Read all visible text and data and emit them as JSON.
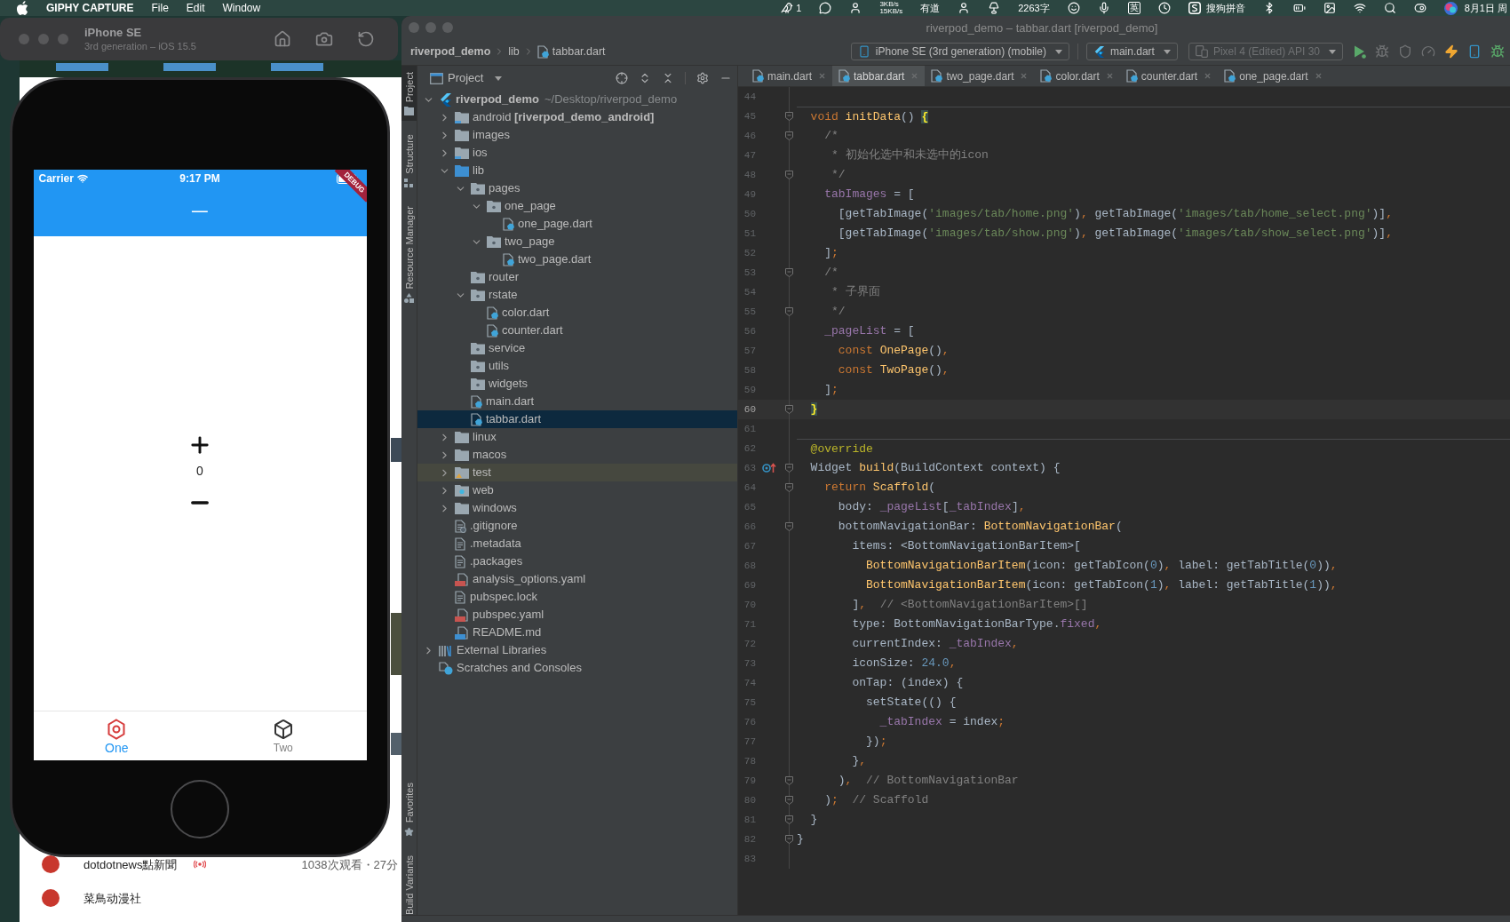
{
  "menu_bar": {
    "app_name": "GIPHY CAPTURE",
    "menus": [
      "File",
      "Edit",
      "Window"
    ],
    "notification_count": "1",
    "network_up": "3KB/s",
    "network_down": "15KB/s",
    "app_label": "有道",
    "word_count": "2263字",
    "input_mode": "英",
    "input_method": "搜狗拼音",
    "date": "8月1日 周"
  },
  "simulator": {
    "device": "iPhone SE",
    "subtitle": "3rd generation – iOS 15.5"
  },
  "phone_app": {
    "carrier": "Carrier",
    "time": "9:17 PM",
    "title": "一",
    "banner": "DEBUG",
    "counter": "0",
    "nav_items": [
      {
        "label": "One",
        "selected": true
      },
      {
        "label": "Two",
        "selected": false
      }
    ]
  },
  "browser_page": {
    "items": [
      {
        "channel": "dotdotnews點新聞",
        "live": true,
        "stats": "1038次观看・27分"
      },
      {
        "channel": "菜鳥动漫社",
        "live": false
      }
    ]
  },
  "ide_window": {
    "title": "riverpod_demo – tabbar.dart [riverpod_demo]",
    "breadcrumbs": [
      "riverpod_demo",
      "lib",
      "tabbar.dart"
    ],
    "run_configs": [
      {
        "label": "iPhone SE (3rd generation) (mobile)",
        "disabled": false
      },
      {
        "label": "main.dart",
        "disabled": false
      },
      {
        "label": "Pixel 4 (Edited) API 30",
        "disabled": true
      }
    ]
  },
  "tool_strip": {
    "top": [
      {
        "label": "Project",
        "selected": true
      },
      {
        "label": "Structure",
        "selected": false
      },
      {
        "label": "Resource Manager",
        "selected": false
      }
    ],
    "bottom": [
      {
        "label": "Favorites",
        "selected": false
      },
      {
        "label": "Build Variants",
        "selected": false
      }
    ]
  },
  "project_panel": {
    "title": "Project"
  },
  "project_tree": [
    {
      "label": "riverpod_demo",
      "path": "~/Desktop/riverpod_demo",
      "kind": "flutter_project",
      "expanded": true,
      "selected": false,
      "children": [
        {
          "label": "android **[riverpod_demo_android]**",
          "kind": "module",
          "expanded": false,
          "selected": false
        },
        {
          "label": "images",
          "kind": "folder",
          "expanded": false,
          "selected": false
        },
        {
          "label": "ios",
          "kind": "module",
          "expanded": false,
          "selected": false
        },
        {
          "label": "lib",
          "kind": "source_root",
          "expanded": true,
          "selected": false,
          "children": [
            {
              "label": "pages",
              "kind": "package",
              "expanded": true,
              "selected": false,
              "children": [
                {
                  "label": "one_page",
                  "kind": "package",
                  "expanded": true,
                  "selected": false,
                  "children": [
                    {
                      "label": "one_page.dart",
                      "kind": "dart",
                      "selected": false
                    }
                  ]
                },
                {
                  "label": "two_page",
                  "kind": "package",
                  "expanded": true,
                  "selected": false,
                  "children": [
                    {
                      "label": "two_page.dart",
                      "kind": "dart",
                      "selected": false
                    }
                  ]
                }
              ]
            },
            {
              "label": "router",
              "kind": "package",
              "selected": false
            },
            {
              "label": "rstate",
              "kind": "package",
              "expanded": true,
              "selected": false,
              "children": [
                {
                  "label": "color.dart",
                  "kind": "dart",
                  "selected": false
                },
                {
                  "label": "counter.dart",
                  "kind": "dart",
                  "selected": false
                }
              ]
            },
            {
              "label": "service",
              "kind": "package",
              "selected": false
            },
            {
              "label": "utils",
              "kind": "package",
              "selected": false
            },
            {
              "label": "widgets",
              "kind": "package",
              "selected": false
            },
            {
              "label": "main.dart",
              "kind": "dart",
              "selected": false
            },
            {
              "label": "tabbar.dart",
              "kind": "dart",
              "selected": true
            }
          ]
        },
        {
          "label": "linux",
          "kind": "folder",
          "expanded": false,
          "selected": false
        },
        {
          "label": "macos",
          "kind": "folder",
          "expanded": false,
          "selected": false
        },
        {
          "label": "test",
          "kind": "test_root",
          "expanded": false,
          "selected": false
        },
        {
          "label": "web",
          "kind": "web",
          "expanded": false,
          "selected": false
        },
        {
          "label": "windows",
          "kind": "folder",
          "expanded": false,
          "selected": false
        },
        {
          "label": ".gitignore",
          "kind": "ignore",
          "selected": false
        },
        {
          "label": ".metadata",
          "kind": "text",
          "selected": false
        },
        {
          "label": ".packages",
          "kind": "text",
          "selected": false
        },
        {
          "label": "analysis_options.yaml",
          "kind": "yaml",
          "selected": false
        },
        {
          "label": "pubspec.lock",
          "kind": "text",
          "selected": false
        },
        {
          "label": "pubspec.yaml",
          "kind": "yaml",
          "selected": false
        },
        {
          "label": "README.md",
          "kind": "markdown",
          "selected": false
        }
      ]
    },
    {
      "label": "External Libraries",
      "kind": "libraries",
      "expanded": false,
      "selected": false
    },
    {
      "label": "Scratches and Consoles",
      "kind": "scratches",
      "selected": false
    }
  ],
  "editor_tabs": [
    {
      "label": "main.dart",
      "selected": false
    },
    {
      "label": "tabbar.dart",
      "selected": true
    },
    {
      "label": "two_page.dart",
      "selected": false
    },
    {
      "label": "color.dart",
      "selected": false
    },
    {
      "label": "counter.dart",
      "selected": false
    },
    {
      "label": "one_page.dart",
      "selected": false
    }
  ],
  "editor_lines": [
    {
      "number": "44",
      "current": false,
      "fold": false,
      "override_marker": false,
      "method_separator": false
    },
    {
      "number": "45",
      "current": false,
      "fold": true,
      "override_marker": false,
      "method_separator": true,
      "tokens": [
        {
          "kind": "keyword",
          "text": "  void "
        },
        {
          "kind": "function",
          "text": "initData"
        },
        {
          "kind": "plain",
          "text": "() "
        },
        {
          "kind": "brace",
          "text": "{"
        }
      ]
    },
    {
      "number": "46",
      "current": false,
      "fold": true,
      "override_marker": false,
      "method_separator": false,
      "tokens": [
        {
          "kind": "comment",
          "text": "    /*"
        }
      ]
    },
    {
      "number": "47",
      "current": false,
      "fold": false,
      "override_marker": false,
      "method_separator": false,
      "tokens": [
        {
          "kind": "comment",
          "text": "     * 初始化选中和未选中的icon"
        }
      ]
    },
    {
      "number": "48",
      "current": false,
      "fold": true,
      "override_marker": false,
      "method_separator": false,
      "tokens": [
        {
          "kind": "comment",
          "text": "     */"
        }
      ]
    },
    {
      "number": "49",
      "current": false,
      "fold": false,
      "override_marker": false,
      "method_separator": false,
      "tokens": [
        {
          "kind": "field",
          "text": "    tabImages"
        },
        {
          "kind": "plain",
          "text": " = ["
        }
      ]
    },
    {
      "number": "50",
      "current": false,
      "fold": false,
      "override_marker": false,
      "method_separator": false,
      "tokens": [
        {
          "kind": "plain",
          "text": "      [getTabImage("
        },
        {
          "kind": "string",
          "text": "'images/tab/home.png'"
        },
        {
          "kind": "plain",
          "text": ")"
        },
        {
          "kind": "punct",
          "text": ", "
        },
        {
          "kind": "plain",
          "text": "getTabImage("
        },
        {
          "kind": "string",
          "text": "'images/tab/home_select.png'"
        },
        {
          "kind": "plain",
          "text": ")]"
        },
        {
          "kind": "punct",
          "text": ","
        }
      ]
    },
    {
      "number": "51",
      "current": false,
      "fold": false,
      "override_marker": false,
      "method_separator": false,
      "tokens": [
        {
          "kind": "plain",
          "text": "      [getTabImage("
        },
        {
          "kind": "string",
          "text": "'images/tab/show.png'"
        },
        {
          "kind": "plain",
          "text": ")"
        },
        {
          "kind": "punct",
          "text": ", "
        },
        {
          "kind": "plain",
          "text": "getTabImage("
        },
        {
          "kind": "string",
          "text": "'images/tab/show_select.png'"
        },
        {
          "kind": "plain",
          "text": ")]"
        },
        {
          "kind": "punct",
          "text": ","
        }
      ]
    },
    {
      "number": "52",
      "current": false,
      "fold": false,
      "override_marker": false,
      "method_separator": false,
      "tokens": [
        {
          "kind": "plain",
          "text": "    ]"
        },
        {
          "kind": "punct",
          "text": ";"
        }
      ]
    },
    {
      "number": "53",
      "current": false,
      "fold": true,
      "override_marker": false,
      "method_separator": false,
      "tokens": [
        {
          "kind": "comment",
          "text": "    /*"
        }
      ]
    },
    {
      "number": "54",
      "current": false,
      "fold": false,
      "override_marker": false,
      "method_separator": false,
      "tokens": [
        {
          "kind": "comment",
          "text": "     * 子界面"
        }
      ]
    },
    {
      "number": "55",
      "current": false,
      "fold": true,
      "override_marker": false,
      "method_separator": false,
      "tokens": [
        {
          "kind": "comment",
          "text": "     */"
        }
      ]
    },
    {
      "number": "56",
      "current": false,
      "fold": false,
      "override_marker": false,
      "method_separator": false,
      "tokens": [
        {
          "kind": "field",
          "text": "    _pageList"
        },
        {
          "kind": "plain",
          "text": " = ["
        }
      ]
    },
    {
      "number": "57",
      "current": false,
      "fold": false,
      "override_marker": false,
      "method_separator": false,
      "tokens": [
        {
          "kind": "keyword",
          "text": "      const "
        },
        {
          "kind": "function",
          "text": "OnePage"
        },
        {
          "kind": "plain",
          "text": "()"
        },
        {
          "kind": "punct",
          "text": ","
        }
      ]
    },
    {
      "number": "58",
      "current": false,
      "fold": false,
      "override_marker": false,
      "method_separator": false,
      "tokens": [
        {
          "kind": "keyword",
          "text": "      const "
        },
        {
          "kind": "function",
          "text": "TwoPage"
        },
        {
          "kind": "plain",
          "text": "()"
        },
        {
          "kind": "punct",
          "text": ","
        }
      ]
    },
    {
      "number": "59",
      "current": false,
      "fold": false,
      "override_marker": false,
      "method_separator": false,
      "tokens": [
        {
          "kind": "plain",
          "text": "    ]"
        },
        {
          "kind": "punct",
          "text": ";"
        }
      ]
    },
    {
      "number": "60",
      "current": true,
      "fold": true,
      "override_marker": false,
      "method_separator": false,
      "tokens": [
        {
          "kind": "brace",
          "text": "  }"
        }
      ]
    },
    {
      "number": "61",
      "current": false,
      "fold": false,
      "override_marker": false,
      "method_separator": false
    },
    {
      "number": "62",
      "current": false,
      "fold": false,
      "override_marker": false,
      "method_separator": true,
      "tokens": [
        {
          "kind": "annotation",
          "text": "  @override"
        }
      ]
    },
    {
      "number": "63",
      "current": false,
      "fold": true,
      "override_marker": true,
      "method_separator": false,
      "tokens": [
        {
          "kind": "plain",
          "text": "  Widget "
        },
        {
          "kind": "function",
          "text": "build"
        },
        {
          "kind": "plain",
          "text": "(BuildContext context) {"
        }
      ]
    },
    {
      "number": "64",
      "current": false,
      "fold": true,
      "override_marker": false,
      "method_separator": false,
      "tokens": [
        {
          "kind": "keyword",
          "text": "    return "
        },
        {
          "kind": "function",
          "text": "Scaffold"
        },
        {
          "kind": "plain",
          "text": "("
        }
      ]
    },
    {
      "number": "65",
      "current": false,
      "fold": false,
      "override_marker": false,
      "method_separator": false,
      "tokens": [
        {
          "kind": "plain",
          "text": "      body: "
        },
        {
          "kind": "field",
          "text": "_pageList"
        },
        {
          "kind": "plain",
          "text": "["
        },
        {
          "kind": "field",
          "text": "_tabIndex"
        },
        {
          "kind": "plain",
          "text": "]"
        },
        {
          "kind": "punct",
          "text": ","
        }
      ]
    },
    {
      "number": "66",
      "current": false,
      "fold": true,
      "override_marker": false,
      "method_separator": false,
      "tokens": [
        {
          "kind": "plain",
          "text": "      bottomNavigationBar: "
        },
        {
          "kind": "function",
          "text": "BottomNavigationBar"
        },
        {
          "kind": "plain",
          "text": "("
        }
      ]
    },
    {
      "number": "67",
      "current": false,
      "fold": false,
      "override_marker": false,
      "method_separator": false,
      "tokens": [
        {
          "kind": "plain",
          "text": "        items: <BottomNavigationBarItem>["
        }
      ]
    },
    {
      "number": "68",
      "current": false,
      "fold": false,
      "override_marker": false,
      "method_separator": false,
      "tokens": [
        {
          "kind": "function",
          "text": "          BottomNavigationBarItem"
        },
        {
          "kind": "plain",
          "text": "(icon: getTabIcon("
        },
        {
          "kind": "number",
          "text": "0"
        },
        {
          "kind": "plain",
          "text": ")"
        },
        {
          "kind": "punct",
          "text": ", "
        },
        {
          "kind": "plain",
          "text": "label: getTabTitle("
        },
        {
          "kind": "number",
          "text": "0"
        },
        {
          "kind": "plain",
          "text": "))"
        },
        {
          "kind": "punct",
          "text": ","
        }
      ]
    },
    {
      "number": "69",
      "current": false,
      "fold": false,
      "override_marker": false,
      "method_separator": false,
      "tokens": [
        {
          "kind": "function",
          "text": "          BottomNavigationBarItem"
        },
        {
          "kind": "plain",
          "text": "(icon: getTabIcon("
        },
        {
          "kind": "number",
          "text": "1"
        },
        {
          "kind": "plain",
          "text": ")"
        },
        {
          "kind": "punct",
          "text": ", "
        },
        {
          "kind": "plain",
          "text": "label: getTabTitle("
        },
        {
          "kind": "number",
          "text": "1"
        },
        {
          "kind": "plain",
          "text": "))"
        },
        {
          "kind": "punct",
          "text": ","
        }
      ]
    },
    {
      "number": "70",
      "current": false,
      "fold": false,
      "override_marker": false,
      "method_separator": false,
      "tokens": [
        {
          "kind": "plain",
          "text": "        ]"
        },
        {
          "kind": "punct",
          "text": ","
        },
        {
          "kind": "comment",
          "text": "  // <BottomNavigationBarItem>[]"
        }
      ]
    },
    {
      "number": "71",
      "current": false,
      "fold": false,
      "override_marker": false,
      "method_separator": false,
      "tokens": [
        {
          "kind": "plain",
          "text": "        type: BottomNavigationBarType."
        },
        {
          "kind": "field",
          "text": "fixed"
        },
        {
          "kind": "punct",
          "text": ","
        }
      ]
    },
    {
      "number": "72",
      "current": false,
      "fold": false,
      "override_marker": false,
      "method_separator": false,
      "tokens": [
        {
          "kind": "plain",
          "text": "        currentIndex: "
        },
        {
          "kind": "field",
          "text": "_tabIndex"
        },
        {
          "kind": "punct",
          "text": ","
        }
      ]
    },
    {
      "number": "73",
      "current": false,
      "fold": false,
      "override_marker": false,
      "method_separator": false,
      "tokens": [
        {
          "kind": "plain",
          "text": "        iconSize: "
        },
        {
          "kind": "number",
          "text": "24.0"
        },
        {
          "kind": "punct",
          "text": ","
        }
      ]
    },
    {
      "number": "74",
      "current": false,
      "fold": false,
      "override_marker": false,
      "method_separator": false,
      "tokens": [
        {
          "kind": "plain",
          "text": "        onTap: (index) {"
        }
      ]
    },
    {
      "number": "75",
      "current": false,
      "fold": false,
      "override_marker": false,
      "method_separator": false,
      "tokens": [
        {
          "kind": "plain",
          "text": "          setState(() {"
        }
      ]
    },
    {
      "number": "76",
      "current": false,
      "fold": false,
      "override_marker": false,
      "method_separator": false,
      "tokens": [
        {
          "kind": "field",
          "text": "            _tabIndex"
        },
        {
          "kind": "plain",
          "text": " = index"
        },
        {
          "kind": "punct",
          "text": ";"
        }
      ]
    },
    {
      "number": "77",
      "current": false,
      "fold": false,
      "override_marker": false,
      "method_separator": false,
      "tokens": [
        {
          "kind": "plain",
          "text": "          })"
        },
        {
          "kind": "punct",
          "text": ";"
        }
      ]
    },
    {
      "number": "78",
      "current": false,
      "fold": false,
      "override_marker": false,
      "method_separator": false,
      "tokens": [
        {
          "kind": "plain",
          "text": "        }"
        },
        {
          "kind": "punct",
          "text": ","
        }
      ]
    },
    {
      "number": "79",
      "current": false,
      "fold": true,
      "override_marker": false,
      "method_separator": false,
      "tokens": [
        {
          "kind": "plain",
          "text": "      )"
        },
        {
          "kind": "punct",
          "text": ","
        },
        {
          "kind": "comment",
          "text": "  // BottomNavigationBar"
        }
      ]
    },
    {
      "number": "80",
      "current": false,
      "fold": true,
      "override_marker": false,
      "method_separator": false,
      "tokens": [
        {
          "kind": "plain",
          "text": "    )"
        },
        {
          "kind": "punct",
          "text": ";"
        },
        {
          "kind": "comment",
          "text": "  // Scaffold"
        }
      ]
    },
    {
      "number": "81",
      "current": false,
      "fold": true,
      "override_marker": false,
      "method_separator": false,
      "tokens": [
        {
          "kind": "plain",
          "text": "  }"
        }
      ]
    },
    {
      "number": "82",
      "current": false,
      "fold": true,
      "override_marker": false,
      "method_separator": false,
      "tokens": [
        {
          "kind": "plain",
          "text": "}"
        }
      ]
    },
    {
      "number": "83",
      "current": false,
      "fold": false,
      "override_marker": false,
      "method_separator": false
    }
  ]
}
